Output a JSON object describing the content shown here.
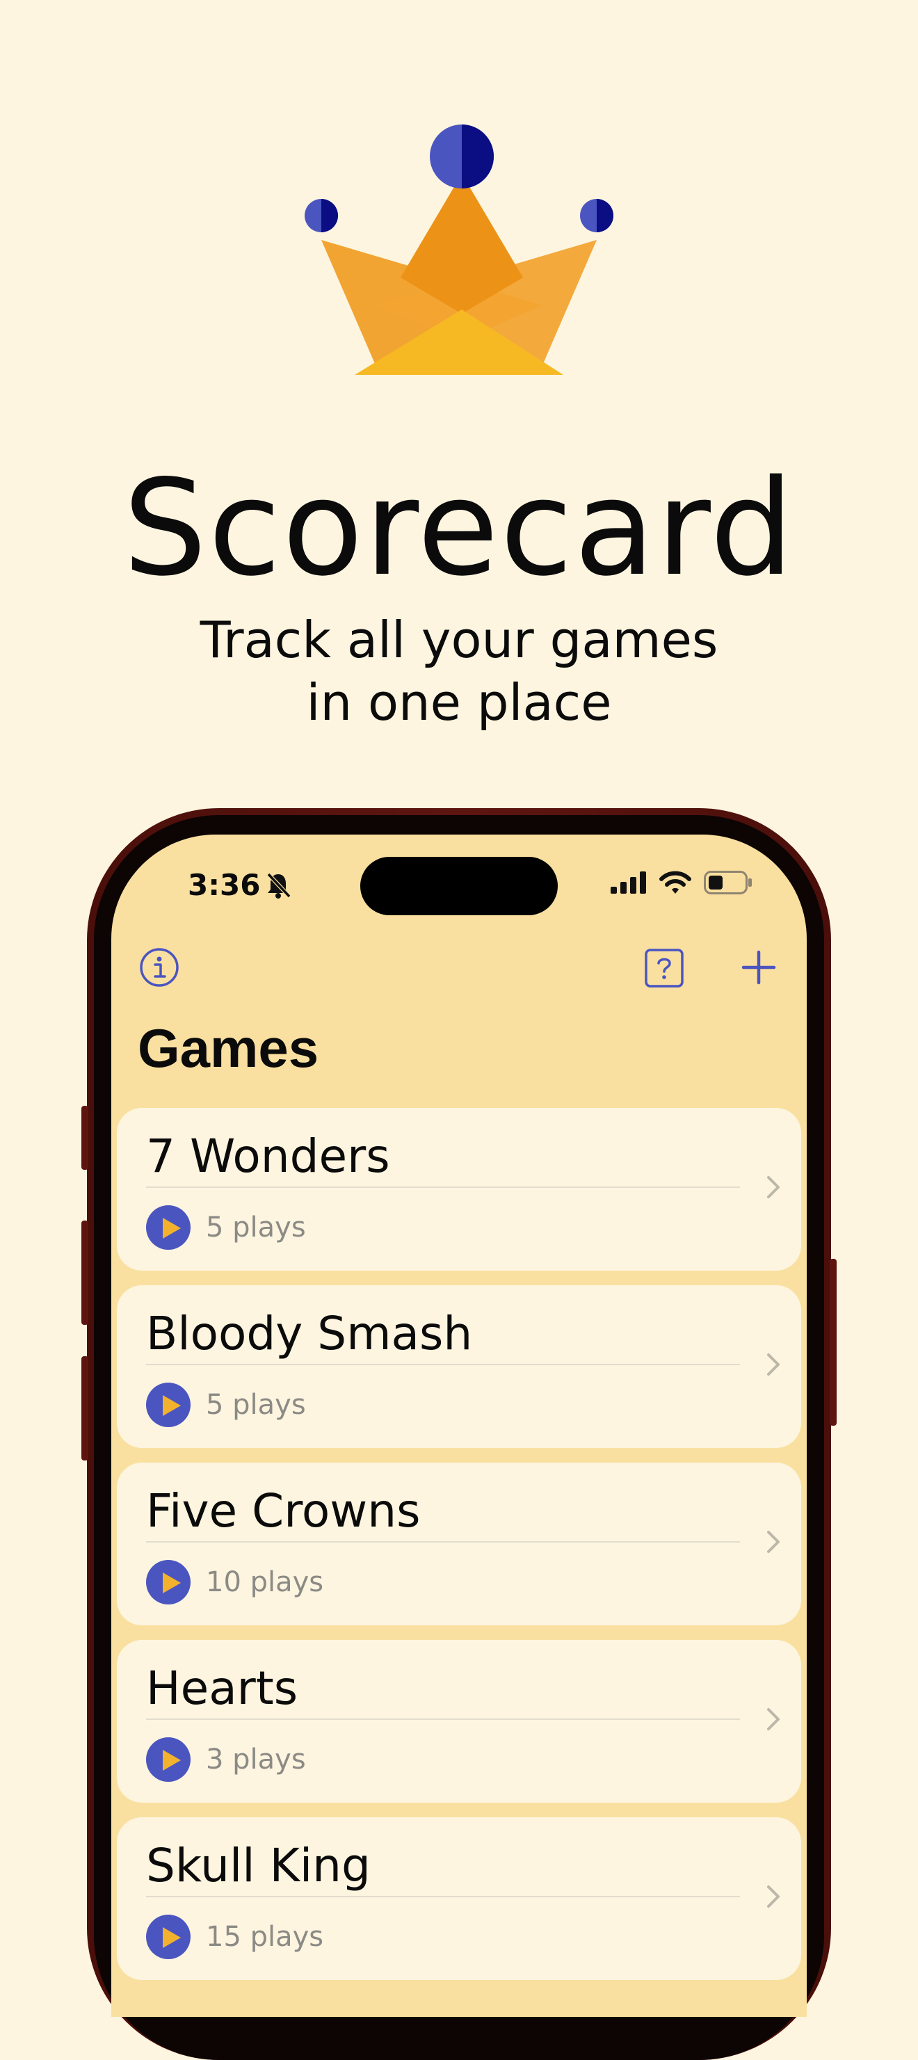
{
  "app": {
    "name": "Scorecard",
    "tagline_line1": "Track all your games",
    "tagline_line2": "in one place"
  },
  "colors": {
    "background": "#fdf5e0",
    "screen_background": "#fae0a0",
    "accent": "#4b55c0",
    "crown_orange": "#f2a432",
    "crown_yellow": "#f6b924",
    "frame": "#5e1510"
  },
  "status_bar": {
    "time": "3:36",
    "icons": [
      "bell-slash-icon",
      "cellular-signal-icon",
      "wifi-icon",
      "battery-icon"
    ]
  },
  "nav": {
    "left_icon": "info-icon",
    "right_icons": [
      "help-icon",
      "add-icon"
    ],
    "title": "Games"
  },
  "games": [
    {
      "name": "7 Wonders",
      "plays": "5 plays"
    },
    {
      "name": "Bloody Smash",
      "plays": "5 plays"
    },
    {
      "name": "Five Crowns",
      "plays": "10 plays"
    },
    {
      "name": "Hearts",
      "plays": "3 plays"
    },
    {
      "name": "Skull King",
      "plays": "15 plays"
    }
  ]
}
